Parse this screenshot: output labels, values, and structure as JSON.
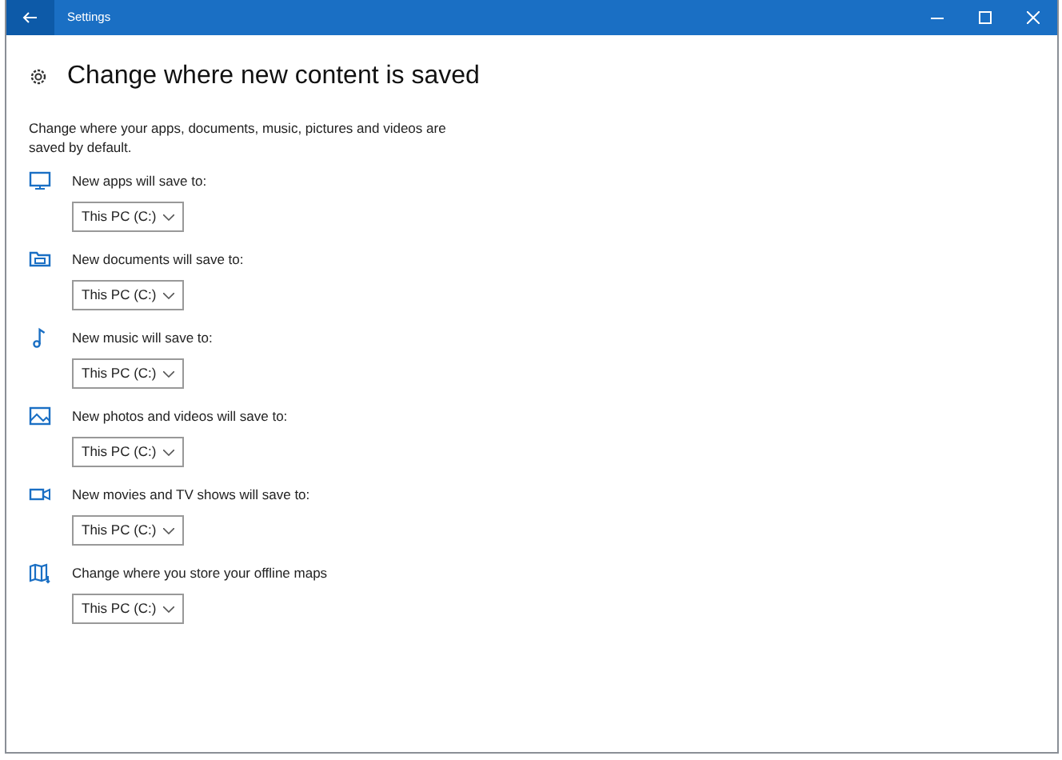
{
  "window": {
    "title": "Settings"
  },
  "page": {
    "title": "Change where new content is saved",
    "description": "Change where your apps, documents, music, pictures and videos are saved by default."
  },
  "locations": [
    {
      "kind": "apps",
      "label": "New apps will save to:",
      "value": "This PC (C:)"
    },
    {
      "kind": "documents",
      "label": "New documents will save to:",
      "value": "This PC (C:)"
    },
    {
      "kind": "music",
      "label": "New music will save to:",
      "value": "This PC (C:)"
    },
    {
      "kind": "photos",
      "label": "New photos and videos will save to:",
      "value": "This PC (C:)"
    },
    {
      "kind": "movies",
      "label": "New movies and TV shows will save to:",
      "value": "This PC (C:)"
    },
    {
      "kind": "maps",
      "label": "Change where you store your offline maps",
      "value": "This PC (C:)"
    }
  ]
}
